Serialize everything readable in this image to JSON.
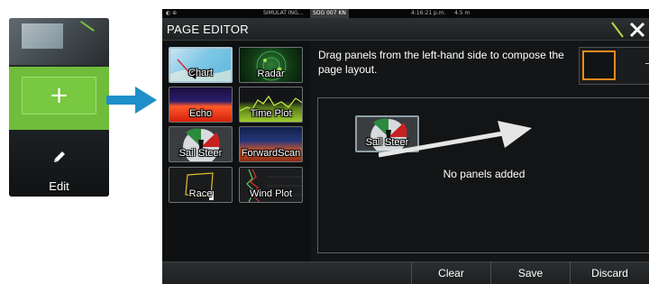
{
  "left_strip": {
    "add_symbol": "+",
    "edit_label": "Edit"
  },
  "status_bar": {
    "source": "SIMULAT ING...",
    "sog": "SOG 007 KN",
    "time": "4:16:21 p.m.",
    "depth": "4.5 m"
  },
  "header": {
    "title": "PAGE EDITOR"
  },
  "panels": [
    {
      "label": "Chart"
    },
    {
      "label": "Radar"
    },
    {
      "label": "Echo"
    },
    {
      "label": "Time Plot"
    },
    {
      "label": "Sail Steer"
    },
    {
      "label": "ForwardScan"
    },
    {
      "label": "Race"
    },
    {
      "label": "Wind Plot"
    }
  ],
  "editor": {
    "instruction": "Drag panels from the left-hand side to compose the page layout.",
    "dragged_panel": "Sail Steer",
    "empty_message": "No panels added"
  },
  "bottom_bar": {
    "clear": "Clear",
    "save": "Save",
    "discard": "Discard"
  },
  "colors": {
    "accent_green": "#6fbd3a",
    "arrow_blue": "#1e8fc8",
    "layout_orange": "#f28a1d"
  },
  "icons": [
    "pencil-icon",
    "close-icon",
    "right-arrow-icon"
  ]
}
